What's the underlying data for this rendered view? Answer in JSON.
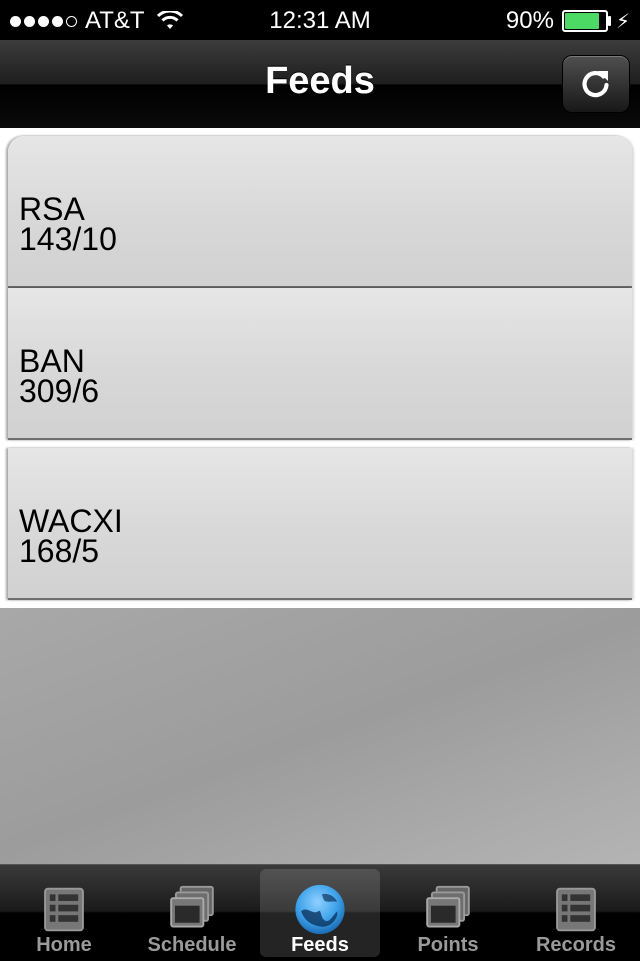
{
  "status_bar": {
    "carrier": "AT&T",
    "time": "12:31 AM",
    "battery_percent": "90%",
    "battery_level": 0.9,
    "signal_bars": 4
  },
  "nav": {
    "title": "Feeds",
    "refresh_icon": "refresh-icon"
  },
  "feeds": [
    {
      "name": "RSA",
      "score": "143/10"
    },
    {
      "name": "BAN",
      "score": "309/6"
    },
    {
      "name": "WACXI",
      "score": "168/5"
    }
  ],
  "tabs": [
    {
      "label": "Home",
      "icon": "list-icon",
      "active": false
    },
    {
      "label": "Schedule",
      "icon": "windows-icon",
      "active": false
    },
    {
      "label": "Feeds",
      "icon": "globe-icon",
      "active": true
    },
    {
      "label": "Points",
      "icon": "windows-icon",
      "active": false
    },
    {
      "label": "Records",
      "icon": "list-icon",
      "active": false
    }
  ],
  "colors": {
    "battery": "#4cd964",
    "active_tab_icon": "#3aa0e8"
  }
}
